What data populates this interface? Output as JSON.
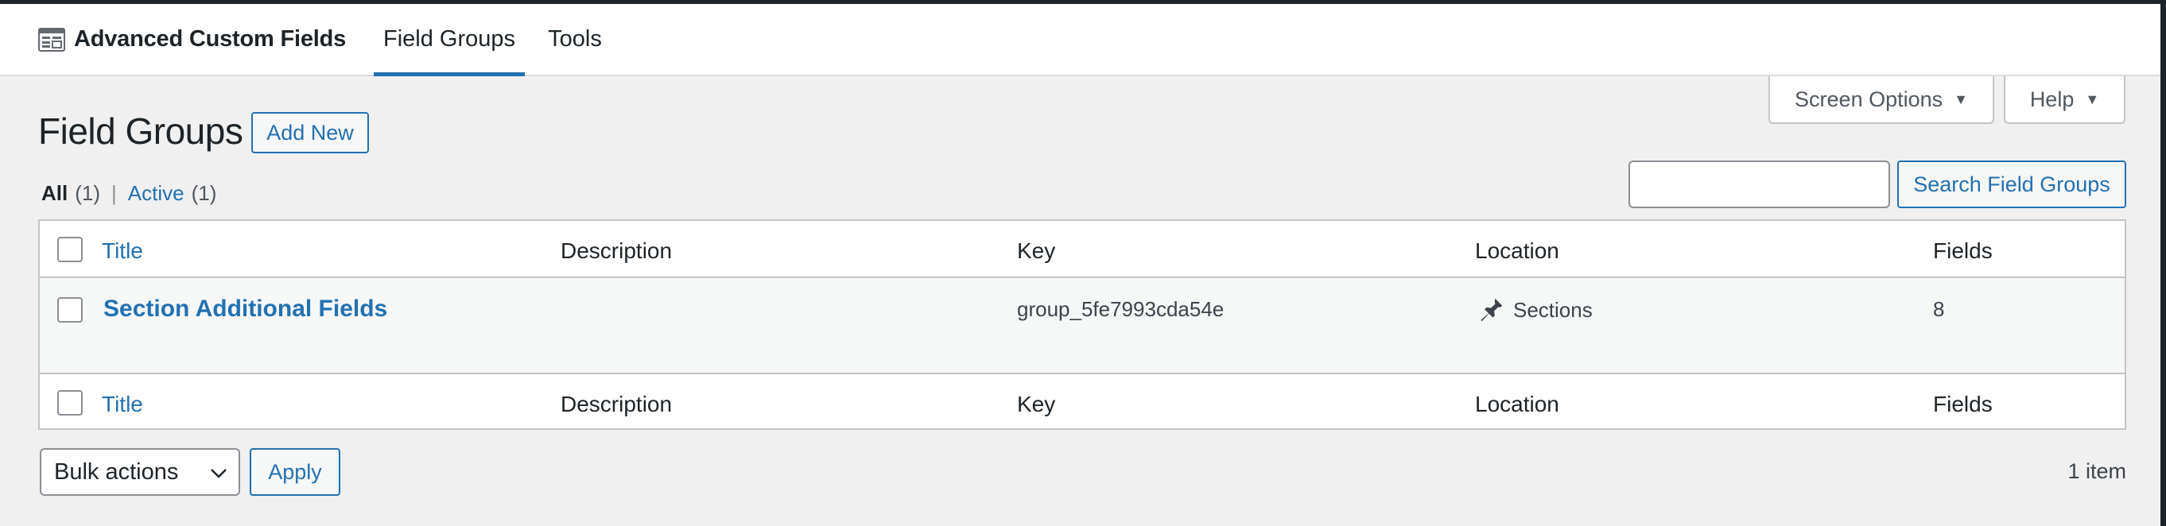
{
  "header": {
    "brand_title": "Advanced Custom Fields",
    "brand_icon": "acf-logo-icon",
    "tabs": [
      {
        "label": "Field Groups",
        "active": true
      },
      {
        "label": "Tools",
        "active": false
      }
    ]
  },
  "screen_meta": {
    "screen_options_label": "Screen Options",
    "help_label": "Help"
  },
  "page": {
    "title": "Field Groups",
    "add_new_label": "Add New"
  },
  "filters": {
    "all_label": "All",
    "all_count": "(1)",
    "separator": "|",
    "active_label": "Active",
    "active_count": "(1)"
  },
  "search": {
    "placeholder": "",
    "value": "",
    "button_label": "Search Field Groups"
  },
  "table": {
    "columns": [
      "Title",
      "Description",
      "Key",
      "Location",
      "Fields"
    ],
    "rows": [
      {
        "title": "Section Additional Fields",
        "description": "",
        "key": "group_5fe7993cda54e",
        "location": "Sections",
        "location_icon": "pin-icon",
        "fields": "8"
      }
    ]
  },
  "bulk": {
    "selected_option": "Bulk actions",
    "apply_label": "Apply"
  },
  "pagination": {
    "item_count": "1 item"
  },
  "colors": {
    "accent": "#2271b1",
    "background": "#f0f0f1",
    "text": "#1d2327",
    "border": "#c3c4c7"
  }
}
